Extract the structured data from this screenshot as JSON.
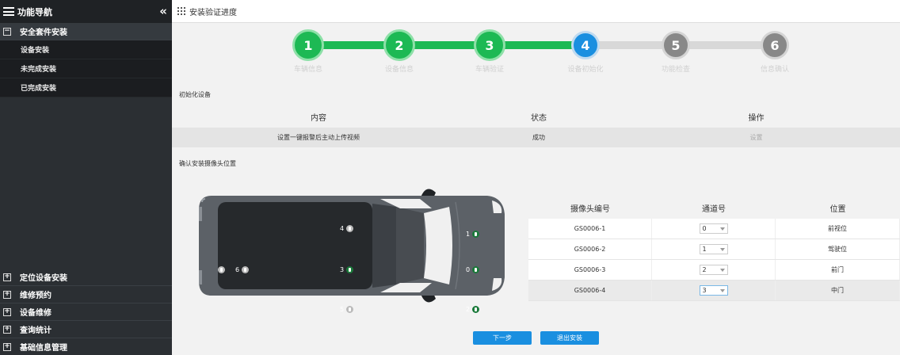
{
  "sidebar": {
    "title": "功能导航",
    "collapse_icon": "double-chevron-left-icon",
    "open_group": {
      "toggle": "−",
      "label": "安全套件安装"
    },
    "sub_items": [
      {
        "label": "设备安装"
      },
      {
        "label": "未完成安装"
      },
      {
        "label": "已完成安装"
      }
    ],
    "groups": [
      {
        "toggle": "+",
        "label": "定位设备安装"
      },
      {
        "toggle": "+",
        "label": "维修预约"
      },
      {
        "toggle": "+",
        "label": "设备维修"
      },
      {
        "toggle": "+",
        "label": "查询统计"
      },
      {
        "toggle": "+",
        "label": "基础信息管理"
      }
    ]
  },
  "topbar": {
    "icon": "grid-icon",
    "title": "安装验证进度"
  },
  "steps": [
    {
      "num": "1",
      "label": "车辆信息",
      "state": "done"
    },
    {
      "num": "2",
      "label": "设备信息",
      "state": "done"
    },
    {
      "num": "3",
      "label": "车辆验证",
      "state": "done"
    },
    {
      "num": "4",
      "label": "设备初始化",
      "state": "current"
    },
    {
      "num": "5",
      "label": "功能检查",
      "state": "todo"
    },
    {
      "num": "6",
      "label": "信息确认",
      "state": "todo"
    }
  ],
  "init_section": {
    "title": "初始化设备",
    "headers": [
      "内容",
      "状态",
      "操作"
    ],
    "row": {
      "content": "设置一键报警后主动上传视频",
      "status": "成功",
      "action": "设置"
    }
  },
  "camera_section": {
    "title": "确认安装摄像头位置",
    "car_labels": [
      "4",
      "6",
      "3",
      "5",
      "1",
      "0",
      "2"
    ],
    "headers": [
      "摄像头编号",
      "通道号",
      "位置"
    ],
    "rows": [
      {
        "id": "GS0006-1",
        "channel": "0",
        "position": "前视位"
      },
      {
        "id": "GS0006-2",
        "channel": "1",
        "position": "驾驶位"
      },
      {
        "id": "GS0006-3",
        "channel": "2",
        "position": "前门"
      },
      {
        "id": "GS0006-4",
        "channel": "3",
        "position": "中门"
      }
    ]
  },
  "buttons": {
    "next": "下一步",
    "exit": "退出安装"
  },
  "colors": {
    "accent": "#1a8fe0",
    "done": "#1db954",
    "todo": "#888888",
    "sidebar": "#2b2f33"
  }
}
